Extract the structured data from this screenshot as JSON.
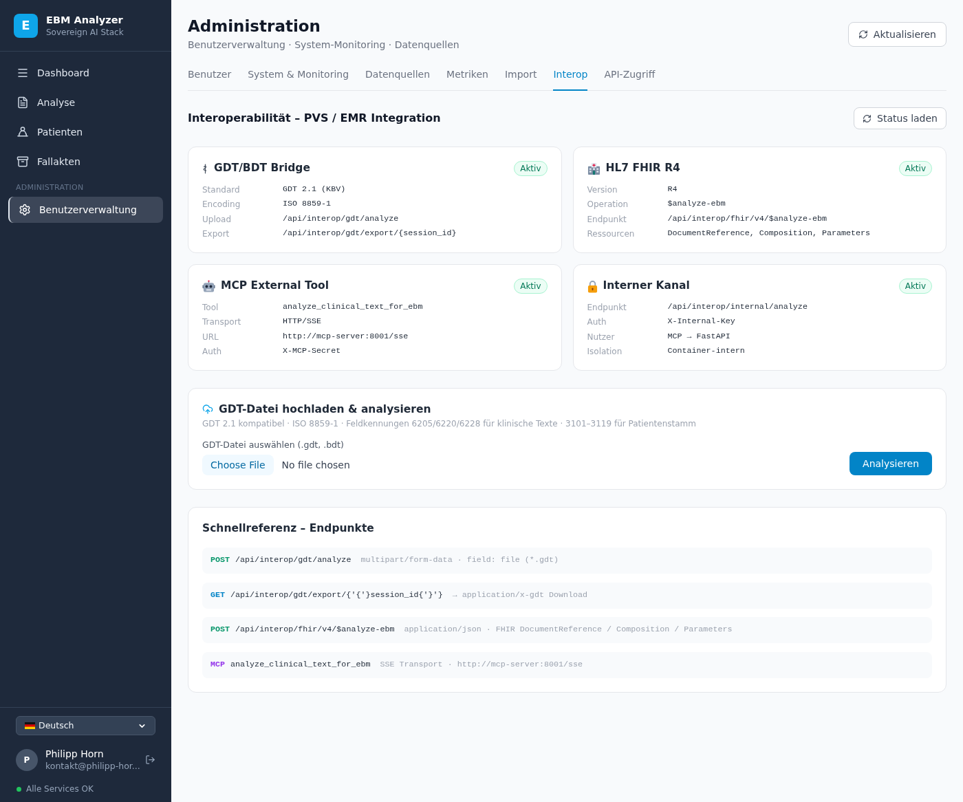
{
  "sidebar": {
    "brand": {
      "logo_letter": "E",
      "name": "EBM Analyzer",
      "tagline": "Sovereign AI Stack"
    },
    "nav": [
      {
        "label": "Dashboard",
        "selected": false
      },
      {
        "label": "Analyse",
        "selected": false
      },
      {
        "label": "Patienten",
        "selected": false
      },
      {
        "label": "Fallakten",
        "selected": false
      }
    ],
    "admin_section": {
      "label": "ADMINISTRATION",
      "items": [
        {
          "label": "Benutzerverwaltung",
          "selected": true
        }
      ]
    },
    "language": {
      "value": "Deutsch"
    },
    "user": {
      "initial": "P",
      "name": "Philipp Horn",
      "email": "kontakt@philipp-hor..."
    },
    "status": {
      "text": "Alle Services OK",
      "color": "#22c55e"
    }
  },
  "header": {
    "title": "Administration",
    "subtitle": "Benutzerverwaltung · System-Monitoring · Datenquellen",
    "refresh_button": "Aktualisieren"
  },
  "tabs": [
    {
      "label": "Benutzer",
      "selected": false
    },
    {
      "label": "System & Monitoring",
      "selected": false
    },
    {
      "label": "Datenquellen",
      "selected": false
    },
    {
      "label": "Metriken",
      "selected": false
    },
    {
      "label": "Import",
      "selected": false
    },
    {
      "label": "Interop",
      "selected": true
    },
    {
      "label": "API-Zugriff",
      "selected": false
    }
  ],
  "section": {
    "title": "Interoperabilität – PVS / EMR Integration",
    "status_button": "Status laden"
  },
  "cards": [
    {
      "title": "GDT/BDT Bridge",
      "badge": "Aktiv",
      "fields": [
        {
          "label": "Standard",
          "value": "GDT 2.1 (KBV)"
        },
        {
          "label": "Encoding",
          "value": "ISO 8859-1"
        },
        {
          "label": "Upload",
          "value": "/api/interop/gdt/analyze"
        },
        {
          "label": "Export",
          "value": "/api/interop/gdt/export/{session_id}"
        }
      ]
    },
    {
      "title": "HL7 FHIR R4",
      "badge": "Aktiv",
      "fields": [
        {
          "label": "Version",
          "value": "R4"
        },
        {
          "label": "Operation",
          "value": "$analyze-ebm"
        },
        {
          "label": "Endpunkt",
          "value": "/api/interop/fhir/v4/$analyze-ebm"
        },
        {
          "label": "Ressourcen",
          "value": "DocumentReference, Composition, Parameters"
        }
      ]
    },
    {
      "title": "MCP External Tool",
      "badge": "Aktiv",
      "fields": [
        {
          "label": "Tool",
          "value": "analyze_clinical_text_for_ebm"
        },
        {
          "label": "Transport",
          "value": "HTTP/SSE"
        },
        {
          "label": "URL",
          "value": "http://mcp-server:8001/sse"
        },
        {
          "label": "Auth",
          "value": "X-MCP-Secret"
        }
      ]
    },
    {
      "title": "Interner Kanal",
      "badge": "Aktiv",
      "fields": [
        {
          "label": "Endpunkt",
          "value": "/api/interop/internal/analyze"
        },
        {
          "label": "Auth",
          "value": "X-Internal-Key"
        },
        {
          "label": "Nutzer",
          "value": "MCP → FastAPI"
        },
        {
          "label": "Isolation",
          "value": "Container-intern"
        }
      ]
    }
  ],
  "upload": {
    "title": "GDT-Datei hochladen & analysieren",
    "description": "GDT 2.1 kompatibel · ISO 8859-1 · Feldkennungen 6205/6220/6228 für klinische Texte · 3101–3119 für Patientenstamm",
    "field_label": "GDT-Datei auswählen (.gdt, .bdt)",
    "choose_button": "Choose File",
    "file_status": "No file chosen",
    "submit_button": "Analysieren"
  },
  "quick_reference": {
    "title": "Schnellreferenz – Endpunkte",
    "endpoints": [
      {
        "method": "POST",
        "color": "#059669",
        "path": "/api/interop/gdt/analyze",
        "note": "multipart/form-data · field: file (*.gdt)"
      },
      {
        "method": "GET",
        "color": "#0284c7",
        "path": "/api/interop/gdt/export/{'{'}session_id{'}'}",
        "note": "→ application/x-gdt Download"
      },
      {
        "method": "POST",
        "color": "#059669",
        "path": "/api/interop/fhir/v4/$analyze-ebm",
        "note": "application/json · FHIR DocumentReference / Composition / Parameters"
      },
      {
        "method": "MCP",
        "color": "#9333ea",
        "path": "analyze_clinical_text_for_ebm",
        "note": "SSE Transport · http://mcp-server:8001/sse"
      }
    ]
  }
}
